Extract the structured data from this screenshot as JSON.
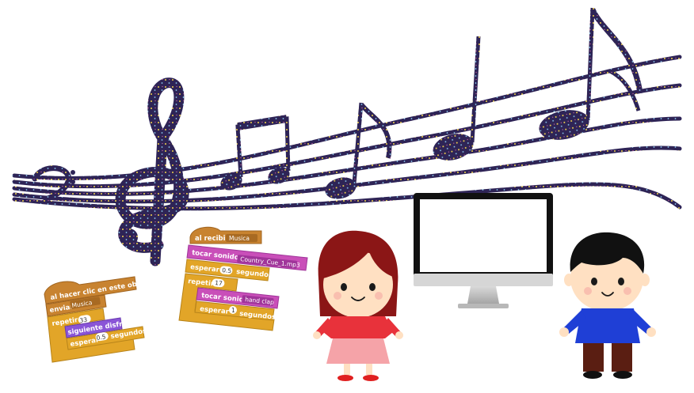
{
  "colors": {
    "staff": "#2a1f4a",
    "staff_highlight": "#7b6fd6",
    "dots": "#f2d24b",
    "events": "#c88330",
    "sound": "#c94fb9",
    "control": "#e2a528",
    "looks": "#8a55d7",
    "monitor_frame": "#111111",
    "monitor_stand": "#c7c7c7",
    "girl_hair": "#8b1616",
    "girl_shirt": "#e8323b",
    "girl_skirt": "#f5a3a8",
    "boy_hair": "#111111",
    "boy_shirt": "#1f3fd6",
    "boy_pants": "#5a1e12",
    "skin": "#ffe0c2"
  },
  "script_left": {
    "hat": "al hacer clic en este objeto",
    "send_label": "enviar",
    "send_value": "Musica",
    "repeat_label": "repetir",
    "repeat_value": "33",
    "next_costume": "siguiente disfraz",
    "wait_label": "esperar",
    "wait_value": "0.5",
    "wait_unit": "segundos"
  },
  "script_right": {
    "hat_label": "al recibir",
    "hat_value": "Musica",
    "play1_label": "tocar sonido",
    "play1_value": "Country_Cue_1.mp3",
    "wait1_label": "esperar",
    "wait1_value": "0.5",
    "wait1_unit": "segundos",
    "repeat_label": "repetir",
    "repeat_value": "17",
    "play2_label": "tocar sonido",
    "play2_value": "hand clap",
    "wait2_label": "esperar",
    "wait2_value": "1",
    "wait2_unit": "segundos"
  },
  "icons": {
    "treble_clef": "treble-clef-icon",
    "bass_clef": "bass-clef-icon",
    "monitor": "computer-monitor-icon"
  }
}
